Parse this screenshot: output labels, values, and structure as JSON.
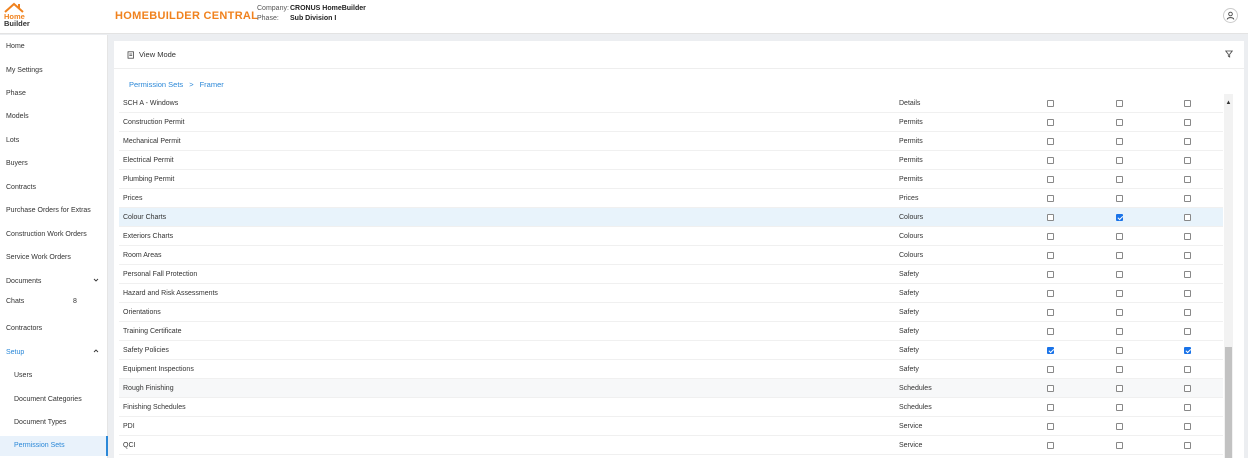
{
  "header": {
    "logo_line1": "Home",
    "logo_line2": "Builder",
    "app_title": "HOMEBUILDER CENTRAL",
    "company_label": "Company:",
    "company_value": "CRONUS HomeBuilder",
    "phase_label": "Phase:",
    "phase_value": "Sub Division I"
  },
  "sidebar": {
    "items": [
      {
        "label": "Home"
      },
      {
        "label": "My Settings"
      },
      {
        "label": "Phase"
      },
      {
        "label": "Models"
      },
      {
        "label": "Lots"
      },
      {
        "label": "Buyers"
      },
      {
        "label": "Contracts"
      },
      {
        "label": "Purchase Orders for Extras"
      },
      {
        "label": "Construction Work Orders"
      },
      {
        "label": "Service Work Orders"
      },
      {
        "label": "Documents"
      },
      {
        "label": "Chats",
        "badge": "8"
      },
      {
        "label": "Contractors"
      },
      {
        "label": "Setup"
      },
      {
        "label": "Users"
      },
      {
        "label": "Document Categories"
      },
      {
        "label": "Document Types"
      },
      {
        "label": "Permission Sets"
      }
    ]
  },
  "toolbar": {
    "view_mode_label": "View Mode"
  },
  "breadcrumb": {
    "root": "Permission Sets",
    "separator": ">",
    "current": "Framer"
  },
  "rows": [
    {
      "name": "SCH A - Windows",
      "category": "Details",
      "c1": false,
      "c2": false,
      "c3": false
    },
    {
      "name": "Construction Permit",
      "category": "Permits",
      "c1": false,
      "c2": false,
      "c3": false
    },
    {
      "name": "Mechanical Permit",
      "category": "Permits",
      "c1": false,
      "c2": false,
      "c3": false
    },
    {
      "name": "Electrical Permit",
      "category": "Permits",
      "c1": false,
      "c2": false,
      "c3": false
    },
    {
      "name": "Plumbing Permit",
      "category": "Permits",
      "c1": false,
      "c2": false,
      "c3": false
    },
    {
      "name": "Prices",
      "category": "Prices",
      "c1": false,
      "c2": false,
      "c3": false
    },
    {
      "name": "Colour Charts",
      "category": "Colours",
      "c1": false,
      "c2": true,
      "c3": false
    },
    {
      "name": "Exteriors Charts",
      "category": "Colours",
      "c1": false,
      "c2": false,
      "c3": false
    },
    {
      "name": "Room Areas",
      "category": "Colours",
      "c1": false,
      "c2": false,
      "c3": false
    },
    {
      "name": "Personal Fall Protection",
      "category": "Safety",
      "c1": false,
      "c2": false,
      "c3": false
    },
    {
      "name": "Hazard and Risk Assessments",
      "category": "Safety",
      "c1": false,
      "c2": false,
      "c3": false
    },
    {
      "name": "Orientations",
      "category": "Safety",
      "c1": false,
      "c2": false,
      "c3": false
    },
    {
      "name": "Training Certificate",
      "category": "Safety",
      "c1": false,
      "c2": false,
      "c3": false
    },
    {
      "name": "Safety Policies",
      "category": "Safety",
      "c1": true,
      "c2": false,
      "c3": true
    },
    {
      "name": "Equipment Inspections",
      "category": "Safety",
      "c1": false,
      "c2": false,
      "c3": false
    },
    {
      "name": "Rough Finishing",
      "category": "Schedules",
      "c1": false,
      "c2": false,
      "c3": false
    },
    {
      "name": "Finishing Schedules",
      "category": "Schedules",
      "c1": false,
      "c2": false,
      "c3": false
    },
    {
      "name": "PDI",
      "category": "Service",
      "c1": false,
      "c2": false,
      "c3": false
    },
    {
      "name": "QCI",
      "category": "Service",
      "c1": false,
      "c2": false,
      "c3": false
    }
  ],
  "colors": {
    "brand": "#f0821e",
    "accent": "#2b88d8",
    "highlight_row": "#e8f3fb",
    "checkbox_checked": "#1a73e8"
  },
  "icons": {
    "logo": "house-logo-icon",
    "user": "user-icon",
    "view_mode": "view-mode-icon",
    "filter": "filter-icon",
    "chevron_down": "chevron-down-icon",
    "chevron_up": "chevron-up-icon",
    "scroll_up": "scroll-up-arrow-icon"
  }
}
